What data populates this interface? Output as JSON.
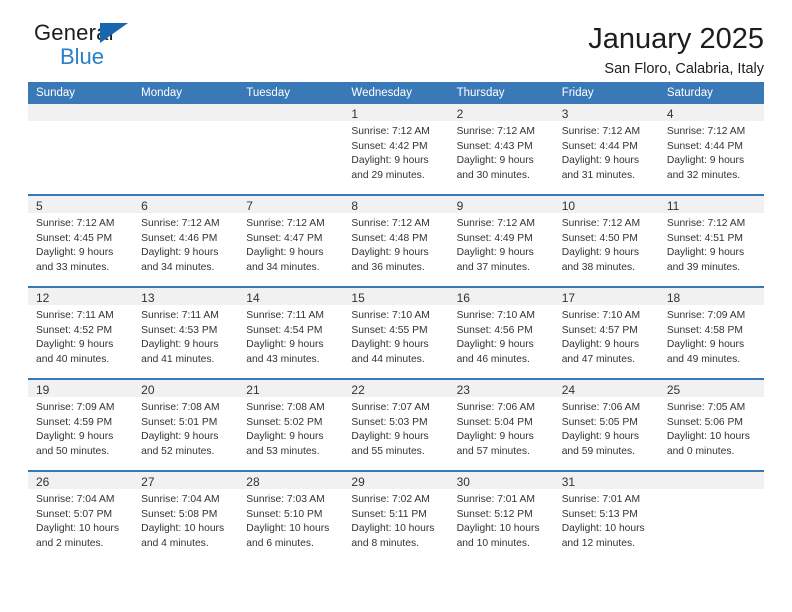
{
  "brand": {
    "name_top": "General",
    "name_bottom": "Blue",
    "triangle_color": "#1667ad",
    "blue_color": "#2a7fc9"
  },
  "header": {
    "title": "January 2025",
    "subtitle": "San Floro, Calabria, Italy"
  },
  "theme": {
    "header_bg": "#3a79b8",
    "daynum_bg": "#f1f1f1",
    "text": "#333333"
  },
  "weekday_headers": [
    "Sunday",
    "Monday",
    "Tuesday",
    "Wednesday",
    "Thursday",
    "Friday",
    "Saturday"
  ],
  "labels": {
    "sunrise": "Sunrise:",
    "sunset": "Sunset:",
    "daylight": "Daylight:"
  },
  "weeks": [
    [
      {
        "day": "",
        "empty": true
      },
      {
        "day": "",
        "empty": true
      },
      {
        "day": "",
        "empty": true
      },
      {
        "day": "1",
        "sunrise": "Sunrise: 7:12 AM",
        "sunset": "Sunset: 4:42 PM",
        "daylight_1": "Daylight: 9 hours",
        "daylight_2": "and 29 minutes."
      },
      {
        "day": "2",
        "sunrise": "Sunrise: 7:12 AM",
        "sunset": "Sunset: 4:43 PM",
        "daylight_1": "Daylight: 9 hours",
        "daylight_2": "and 30 minutes."
      },
      {
        "day": "3",
        "sunrise": "Sunrise: 7:12 AM",
        "sunset": "Sunset: 4:44 PM",
        "daylight_1": "Daylight: 9 hours",
        "daylight_2": "and 31 minutes."
      },
      {
        "day": "4",
        "sunrise": "Sunrise: 7:12 AM",
        "sunset": "Sunset: 4:44 PM",
        "daylight_1": "Daylight: 9 hours",
        "daylight_2": "and 32 minutes."
      }
    ],
    [
      {
        "day": "5",
        "sunrise": "Sunrise: 7:12 AM",
        "sunset": "Sunset: 4:45 PM",
        "daylight_1": "Daylight: 9 hours",
        "daylight_2": "and 33 minutes."
      },
      {
        "day": "6",
        "sunrise": "Sunrise: 7:12 AM",
        "sunset": "Sunset: 4:46 PM",
        "daylight_1": "Daylight: 9 hours",
        "daylight_2": "and 34 minutes."
      },
      {
        "day": "7",
        "sunrise": "Sunrise: 7:12 AM",
        "sunset": "Sunset: 4:47 PM",
        "daylight_1": "Daylight: 9 hours",
        "daylight_2": "and 34 minutes."
      },
      {
        "day": "8",
        "sunrise": "Sunrise: 7:12 AM",
        "sunset": "Sunset: 4:48 PM",
        "daylight_1": "Daylight: 9 hours",
        "daylight_2": "and 36 minutes."
      },
      {
        "day": "9",
        "sunrise": "Sunrise: 7:12 AM",
        "sunset": "Sunset: 4:49 PM",
        "daylight_1": "Daylight: 9 hours",
        "daylight_2": "and 37 minutes."
      },
      {
        "day": "10",
        "sunrise": "Sunrise: 7:12 AM",
        "sunset": "Sunset: 4:50 PM",
        "daylight_1": "Daylight: 9 hours",
        "daylight_2": "and 38 minutes."
      },
      {
        "day": "11",
        "sunrise": "Sunrise: 7:12 AM",
        "sunset": "Sunset: 4:51 PM",
        "daylight_1": "Daylight: 9 hours",
        "daylight_2": "and 39 minutes."
      }
    ],
    [
      {
        "day": "12",
        "sunrise": "Sunrise: 7:11 AM",
        "sunset": "Sunset: 4:52 PM",
        "daylight_1": "Daylight: 9 hours",
        "daylight_2": "and 40 minutes."
      },
      {
        "day": "13",
        "sunrise": "Sunrise: 7:11 AM",
        "sunset": "Sunset: 4:53 PM",
        "daylight_1": "Daylight: 9 hours",
        "daylight_2": "and 41 minutes."
      },
      {
        "day": "14",
        "sunrise": "Sunrise: 7:11 AM",
        "sunset": "Sunset: 4:54 PM",
        "daylight_1": "Daylight: 9 hours",
        "daylight_2": "and 43 minutes."
      },
      {
        "day": "15",
        "sunrise": "Sunrise: 7:10 AM",
        "sunset": "Sunset: 4:55 PM",
        "daylight_1": "Daylight: 9 hours",
        "daylight_2": "and 44 minutes."
      },
      {
        "day": "16",
        "sunrise": "Sunrise: 7:10 AM",
        "sunset": "Sunset: 4:56 PM",
        "daylight_1": "Daylight: 9 hours",
        "daylight_2": "and 46 minutes."
      },
      {
        "day": "17",
        "sunrise": "Sunrise: 7:10 AM",
        "sunset": "Sunset: 4:57 PM",
        "daylight_1": "Daylight: 9 hours",
        "daylight_2": "and 47 minutes."
      },
      {
        "day": "18",
        "sunrise": "Sunrise: 7:09 AM",
        "sunset": "Sunset: 4:58 PM",
        "daylight_1": "Daylight: 9 hours",
        "daylight_2": "and 49 minutes."
      }
    ],
    [
      {
        "day": "19",
        "sunrise": "Sunrise: 7:09 AM",
        "sunset": "Sunset: 4:59 PM",
        "daylight_1": "Daylight: 9 hours",
        "daylight_2": "and 50 minutes."
      },
      {
        "day": "20",
        "sunrise": "Sunrise: 7:08 AM",
        "sunset": "Sunset: 5:01 PM",
        "daylight_1": "Daylight: 9 hours",
        "daylight_2": "and 52 minutes."
      },
      {
        "day": "21",
        "sunrise": "Sunrise: 7:08 AM",
        "sunset": "Sunset: 5:02 PM",
        "daylight_1": "Daylight: 9 hours",
        "daylight_2": "and 53 minutes."
      },
      {
        "day": "22",
        "sunrise": "Sunrise: 7:07 AM",
        "sunset": "Sunset: 5:03 PM",
        "daylight_1": "Daylight: 9 hours",
        "daylight_2": "and 55 minutes."
      },
      {
        "day": "23",
        "sunrise": "Sunrise: 7:06 AM",
        "sunset": "Sunset: 5:04 PM",
        "daylight_1": "Daylight: 9 hours",
        "daylight_2": "and 57 minutes."
      },
      {
        "day": "24",
        "sunrise": "Sunrise: 7:06 AM",
        "sunset": "Sunset: 5:05 PM",
        "daylight_1": "Daylight: 9 hours",
        "daylight_2": "and 59 minutes."
      },
      {
        "day": "25",
        "sunrise": "Sunrise: 7:05 AM",
        "sunset": "Sunset: 5:06 PM",
        "daylight_1": "Daylight: 10 hours",
        "daylight_2": "and 0 minutes."
      }
    ],
    [
      {
        "day": "26",
        "sunrise": "Sunrise: 7:04 AM",
        "sunset": "Sunset: 5:07 PM",
        "daylight_1": "Daylight: 10 hours",
        "daylight_2": "and 2 minutes."
      },
      {
        "day": "27",
        "sunrise": "Sunrise: 7:04 AM",
        "sunset": "Sunset: 5:08 PM",
        "daylight_1": "Daylight: 10 hours",
        "daylight_2": "and 4 minutes."
      },
      {
        "day": "28",
        "sunrise": "Sunrise: 7:03 AM",
        "sunset": "Sunset: 5:10 PM",
        "daylight_1": "Daylight: 10 hours",
        "daylight_2": "and 6 minutes."
      },
      {
        "day": "29",
        "sunrise": "Sunrise: 7:02 AM",
        "sunset": "Sunset: 5:11 PM",
        "daylight_1": "Daylight: 10 hours",
        "daylight_2": "and 8 minutes."
      },
      {
        "day": "30",
        "sunrise": "Sunrise: 7:01 AM",
        "sunset": "Sunset: 5:12 PM",
        "daylight_1": "Daylight: 10 hours",
        "daylight_2": "and 10 minutes."
      },
      {
        "day": "31",
        "sunrise": "Sunrise: 7:01 AM",
        "sunset": "Sunset: 5:13 PM",
        "daylight_1": "Daylight: 10 hours",
        "daylight_2": "and 12 minutes."
      },
      {
        "day": "",
        "empty": true
      }
    ]
  ]
}
